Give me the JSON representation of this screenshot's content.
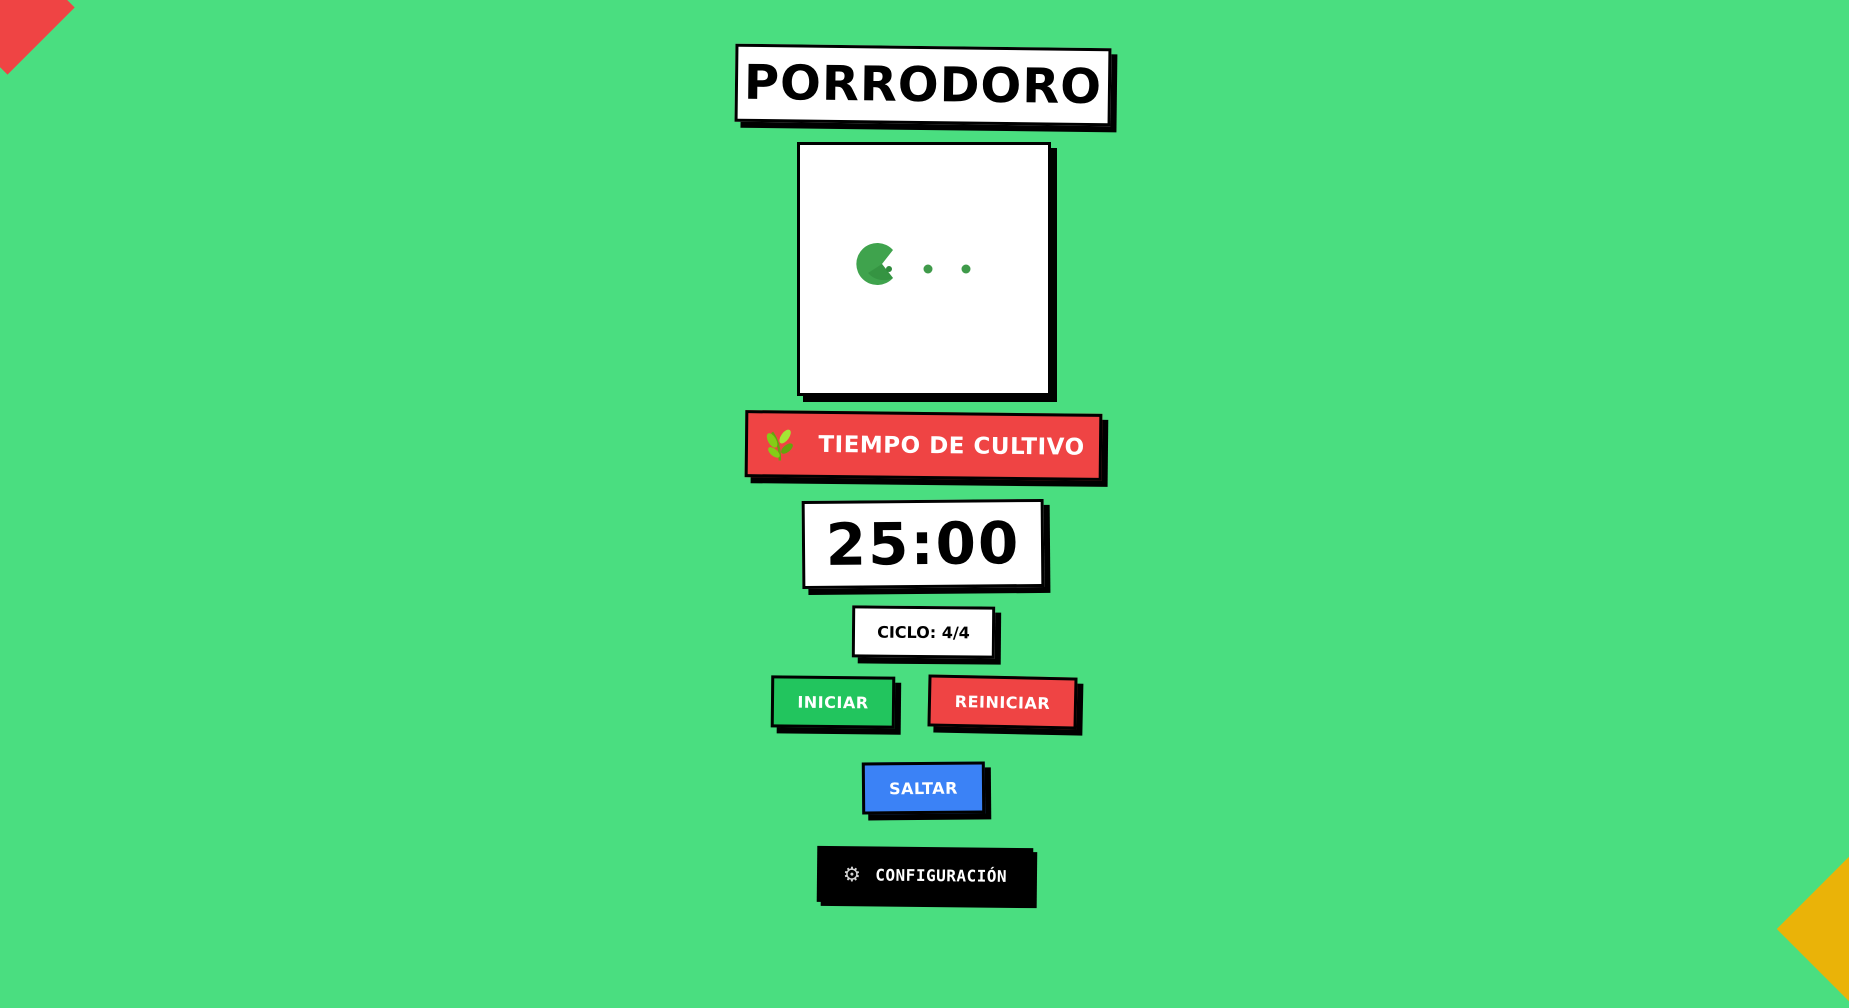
{
  "app": {
    "title": "PORRODORO"
  },
  "phase": {
    "icon": "leaf-sprout-icon",
    "label": "TIEMPO DE CULTIVO"
  },
  "timer": {
    "display": "25:00"
  },
  "cycle": {
    "label": "CICLO: 4/4"
  },
  "controls": {
    "start_label": "INICIAR",
    "reset_label": "REINICIAR",
    "skip_label": "SALTAR"
  },
  "settings": {
    "icon": "gear-icon",
    "label": "CONFIGURACIÓN"
  },
  "colors": {
    "background": "#4ade80",
    "phase": "#ef4444",
    "start": "#22c55e",
    "reset": "#ef4444",
    "skip": "#3b82f6",
    "settings": "#000000",
    "accent_corner_top": "#ef4444",
    "accent_corner_bottom": "#eab308"
  }
}
